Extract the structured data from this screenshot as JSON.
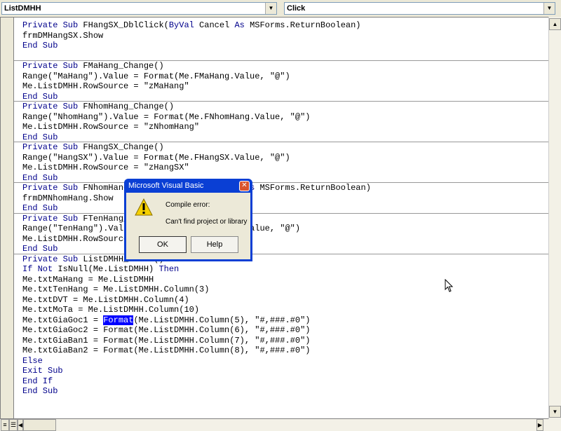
{
  "object_combo": "ListDMHH",
  "procedure_combo": "Click",
  "code_lines": [
    [
      {
        "t": "Private Sub",
        "k": 1
      },
      {
        "t": " FHangSX_DblClick("
      },
      {
        "t": "ByVal",
        "k": 1
      },
      {
        "t": " Cancel "
      },
      {
        "t": "As",
        "k": 1
      },
      {
        "t": " MSForms.ReturnBoolean)"
      }
    ],
    [
      {
        "t": "frmDMHangSX.Show"
      }
    ],
    [
      {
        "t": "End Sub",
        "k": 1
      }
    ],
    [],
    [
      {
        "t": "Private Sub",
        "k": 1
      },
      {
        "t": " FMaHang_Change()"
      }
    ],
    [
      {
        "t": "Range(\"MaHang\").Value = Format(Me.FMaHang.Value, \"@\")"
      }
    ],
    [
      {
        "t": "Me.ListDMHH.RowSource = \"zMaHang\""
      }
    ],
    [
      {
        "t": "End Sub",
        "k": 1
      }
    ],
    [
      {
        "t": "Private Sub",
        "k": 1
      },
      {
        "t": " FNhomHang_Change()"
      }
    ],
    [
      {
        "t": "Range(\"NhomHang\").Value = Format(Me.FNhomHang.Value, \"@\")"
      }
    ],
    [
      {
        "t": "Me.ListDMHH.RowSource = \"zNhomHang\""
      }
    ],
    [
      {
        "t": "End Sub",
        "k": 1
      }
    ],
    [
      {
        "t": "Private Sub",
        "k": 1
      },
      {
        "t": " FHangSX_Change()"
      }
    ],
    [
      {
        "t": "Range(\"HangSX\").Value = Format(Me.FHangSX.Value, \"@\")"
      }
    ],
    [
      {
        "t": "Me.ListDMHH.RowSource = \"zHangSX\""
      }
    ],
    [
      {
        "t": "End Sub",
        "k": 1
      }
    ],
    [
      {
        "t": "Private Sub",
        "k": 1
      },
      {
        "t": " FNhomHang_DblClick("
      },
      {
        "t": "ByVal",
        "k": 1
      },
      {
        "t": " Cancel "
      },
      {
        "t": "As",
        "k": 1
      },
      {
        "t": " MSForms.ReturnBoolean)"
      }
    ],
    [
      {
        "t": "frmDMNhomHang.Show"
      }
    ],
    [
      {
        "t": "End Sub",
        "k": 1
      }
    ],
    [
      {
        "t": "Private Sub",
        "k": 1
      },
      {
        "t": " FTenHang_Change()"
      }
    ],
    [
      {
        "t": "Range(\"TenHang\").Value = Format(Me.FTenHang.Value, \"@\")"
      }
    ],
    [
      {
        "t": "Me.ListDMHH.RowSource = \"zTenHang\""
      }
    ],
    [
      {
        "t": "End Sub",
        "k": 1
      }
    ],
    [
      {
        "t": "Private Sub",
        "k": 1
      },
      {
        "t": " ListDMHH_Click()"
      }
    ],
    [
      {
        "t": "If Not",
        "k": 1
      },
      {
        "t": " IsNull(Me.ListDMHH) "
      },
      {
        "t": "Then",
        "k": 1
      }
    ],
    [
      {
        "t": "Me.txtMaHang = Me.ListDMHH"
      }
    ],
    [
      {
        "t": "Me.txtTenHang = Me.ListDMHH.Column(3)"
      }
    ],
    [
      {
        "t": "Me.txtDVT = Me.ListDMHH.Column(4)"
      }
    ],
    [
      {
        "t": "Me.txtMoTa = Me.ListDMHH.Column(10)"
      }
    ],
    [
      {
        "t": "Me.txtGiaGoc1 = "
      },
      {
        "t": "Format",
        "h": 1
      },
      {
        "t": "(Me.ListDMHH.Column(5), \"#,###.#0\")"
      }
    ],
    [
      {
        "t": "Me.txtGiaGoc2 = Format(Me.ListDMHH.Column(6), \"#,###.#0\")"
      }
    ],
    [
      {
        "t": "Me.txtGiaBan1 = Format(Me.ListDMHH.Column(7), \"#,###.#0\")"
      }
    ],
    [
      {
        "t": "Me.txtGiaBan2 = Format(Me.ListDMHH.Column(8), \"#,###.#0\")"
      }
    ],
    [
      {
        "t": "Else",
        "k": 1
      }
    ],
    [
      {
        "t": "Exit Sub",
        "k": 1
      }
    ],
    [
      {
        "t": "End If",
        "k": 1
      }
    ],
    [
      {
        "t": "End Sub",
        "k": 1
      }
    ]
  ],
  "dialog": {
    "title": "Microsoft Visual Basic",
    "heading": "Compile error:",
    "message": "Can't find project or library",
    "ok": "OK",
    "help": "Help",
    "icon": "warning-icon"
  },
  "colors": {
    "keyword": "#00008b",
    "selection": "#0000ff",
    "titlebar": "#0a3fd4"
  }
}
